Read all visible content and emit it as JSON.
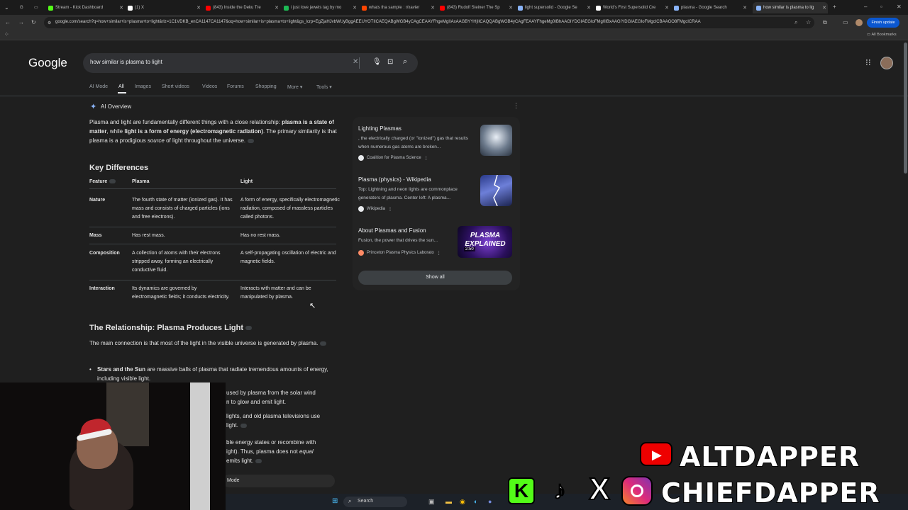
{
  "tabs": [
    {
      "label": "Stream - Kick Dashboard",
      "color": "#53fc18"
    },
    {
      "label": "(1) X",
      "color": "#ffffff"
    },
    {
      "label": "(843) Inside the Deku Tre",
      "color": "#ff0000"
    },
    {
      "label": "i just love jewels tag by mo",
      "color": "#1db954"
    },
    {
      "label": "whats tha sample : r/xavier",
      "color": "#ff4500"
    },
    {
      "label": "(843) Rudolf Steiner The Sp",
      "color": "#ff0000"
    },
    {
      "label": "light supersolid - Google Se",
      "color": "#8ab4f8"
    },
    {
      "label": "World's First Supersolid Cre",
      "color": "#ffffff"
    },
    {
      "label": "plasma - Google Search",
      "color": "#8ab4f8"
    },
    {
      "label": "how similar is plasma to lig",
      "color": "#8ab4f8"
    }
  ],
  "browser": {
    "url": "google.com/search?q=how+similar+is+plasma+to+light&rlz=1C1VDKB_enCA1147CA1147&oq=how+similar+is+plasma+to+light&gs_lcrp=EgZjaHJvbWUyBggAEEUYOTIICAEQABgWGB4yCAgCEAAYFhgeMgIIAxAAGBYYHjIICAQQABgWGB4yCAgFEAAYFhgeMg0IBhAAGIYDGIAEGIoFMg0IBxAAGIYDGIAEGIoFMgcICBAAGO8FMgcICRAA",
    "finish_update": "Finish update",
    "all_bookmarks": "All Bookmarks"
  },
  "google": {
    "logo": "Google",
    "query": "how similar is plasma to light",
    "nav": [
      "AI Mode",
      "All",
      "Images",
      "Short videos",
      "Videos",
      "Forums",
      "Shopping",
      "More",
      "Tools"
    ]
  },
  "overview": {
    "label": "AI Overview",
    "intro_a": "Plasma and light are fundamentally different things with a close relationship: ",
    "intro_b": "plasma is a state of matter",
    "intro_c": ", while ",
    "intro_d": "light is a form of energy (electromagnetic radiation)",
    "intro_e": ". The primary similarity is that plasma is a prodigious ",
    "intro_f": "source",
    "intro_g": " of light throughout the universe.",
    "key_title": "Key Differences",
    "table": {
      "headers": [
        "Feature",
        "Plasma",
        "Light"
      ],
      "rows": [
        {
          "feature": "Nature",
          "plasma": "The fourth state of matter (ionized gas). It has mass and consists of charged particles (ions and free electrons).",
          "light": "A form of energy, specifically electromagnetic radiation, composed of massless particles called photons."
        },
        {
          "feature": "Mass",
          "plasma": "Has rest mass.",
          "light": "Has no rest mass."
        },
        {
          "feature": "Composition",
          "plasma": "A collection of atoms with their electrons stripped away, forming an electrically conductive fluid.",
          "light": "A self-propagating oscillation of electric and magnetic fields."
        },
        {
          "feature": "Interaction",
          "plasma": "Its dynamics are governed by electromagnetic fields; it conducts electricity.",
          "light": "Interacts with matter and can be manipulated by plasma."
        }
      ]
    },
    "relationship_title": "The Relationship: Plasma Produces Light",
    "relationship_text": "The main connection is that most of the light in the visible universe is generated by plasma.",
    "bullet1_bold": "Stars and the Sun",
    "bullet1_text": " are massive balls of plasma that radiate tremendous amounts of energy, including visible light.",
    "frag1a": "used by plasma from the solar wind",
    "frag1b": "n to glow and emit light.",
    "frag2a": "lights, and old plasma televisions use",
    "frag2b": "light.",
    "frag3a": "ble energy states or recombine with",
    "frag3b_a": "ight). Thus, plasma does not ",
    "frag3b_b": "equal",
    "frag3c": "emits light.",
    "ai_mode_btn": "Mode"
  },
  "sources": [
    {
      "title": "Lighting Plasmas",
      "snippet": ", the electrically charged (or \"ionized\") gas that results when numerous gas atoms are broken...",
      "site": "Coalition for Plasma Science"
    },
    {
      "title": "Plasma (physics) - Wikipedia",
      "snippet": "Top: Lightning and neon lights are commonplace generators of plasma. Center left: A plasma...",
      "site": "Wikipedia"
    },
    {
      "title": "About Plasmas and Fusion",
      "snippet": "Fusion, the power that drives the sun...",
      "site": "Princeton Plasma Physics Laborato",
      "video_label": "PLASMA EXPLAINED",
      "duration": "2:50"
    }
  ],
  "show_all": "Show all",
  "taskbar": {
    "search": "Search"
  },
  "overlay": {
    "line1": "ALTDAPPER",
    "line2": "CHIEFDAPPER"
  }
}
